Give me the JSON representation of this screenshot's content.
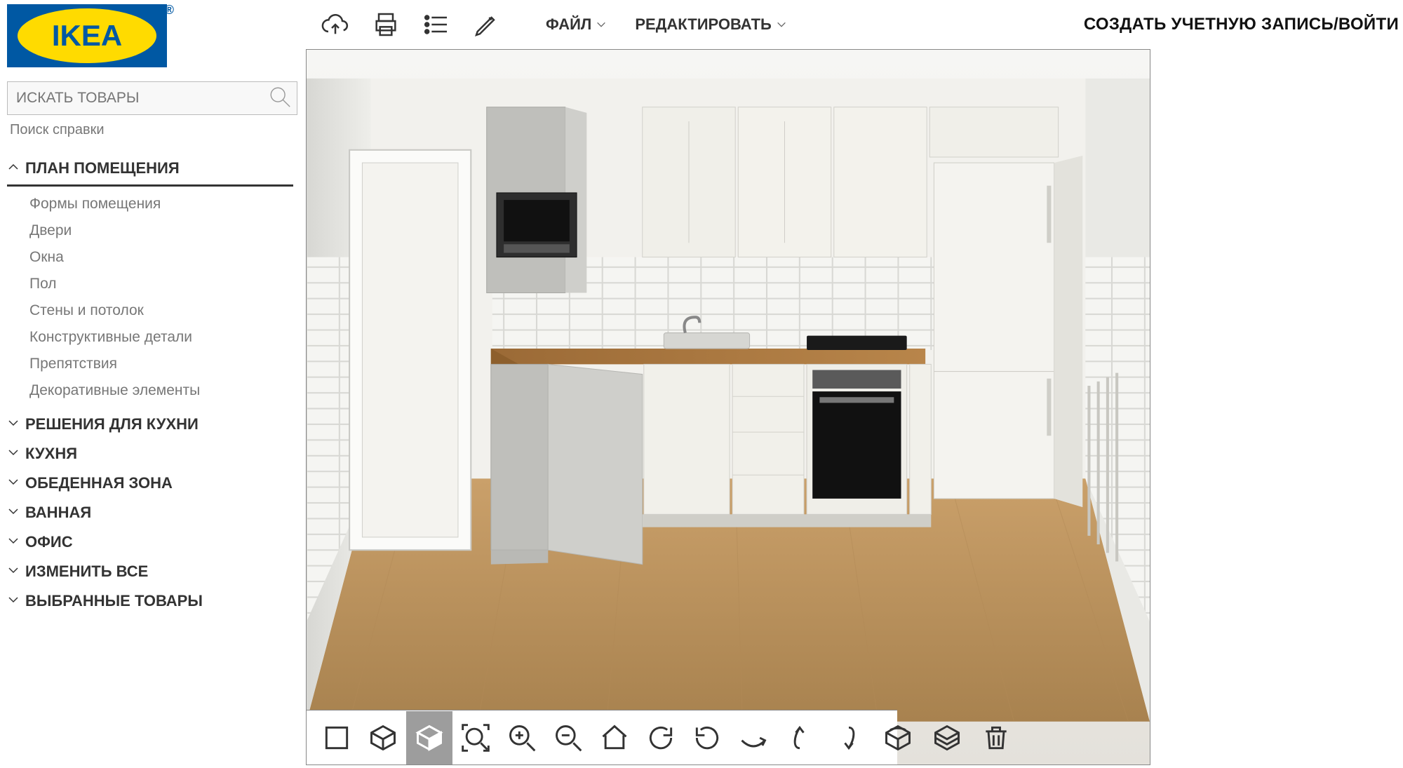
{
  "brand": {
    "name": "IKEA"
  },
  "search": {
    "placeholder": "ИСКАТЬ ТОВАРЫ"
  },
  "help": {
    "label": "Поиск справки"
  },
  "account": {
    "label": "СОЗДАТЬ УЧЕТНУЮ ЗАПИСЬ/ВОЙТИ"
  },
  "menus": {
    "file": "ФАЙЛ",
    "edit": "РЕДАКТИРОВАТЬ"
  },
  "sidebar": {
    "sections": [
      {
        "label": "ПЛАН ПОМЕЩЕНИЯ",
        "open": true,
        "items": [
          "Формы помещения",
          "Двери",
          "Окна",
          "Пол",
          "Стены и потолок",
          "Конструктивные детали",
          "Препятствия",
          "Декоративные элементы"
        ]
      },
      {
        "label": "РЕШЕНИЯ ДЛЯ КУХНИ",
        "open": false
      },
      {
        "label": "КУХНЯ",
        "open": false
      },
      {
        "label": "ОБЕДЕННАЯ ЗОНА",
        "open": false
      },
      {
        "label": "ВАННАЯ",
        "open": false
      },
      {
        "label": "ОФИС",
        "open": false
      },
      {
        "label": "ИЗМЕНИТЬ ВСЕ",
        "open": false
      },
      {
        "label": "ВЫБРАННЫЕ ТОВАРЫ",
        "open": false
      }
    ]
  },
  "toolbar": {
    "icons": [
      "cloud-upload",
      "print",
      "list",
      "pencil"
    ]
  },
  "viewbar": {
    "left": [
      "view-2d",
      "view-3d-wire",
      "view-3d-solid",
      "zoom-fit",
      "zoom-in",
      "zoom-out",
      "home",
      "rotate-cw",
      "rotate-ccw",
      "pan-right"
    ],
    "right": [
      "orbit-up",
      "orbit-down",
      "cube-front",
      "cube-iso",
      "trash"
    ],
    "active": "view-3d-solid"
  }
}
